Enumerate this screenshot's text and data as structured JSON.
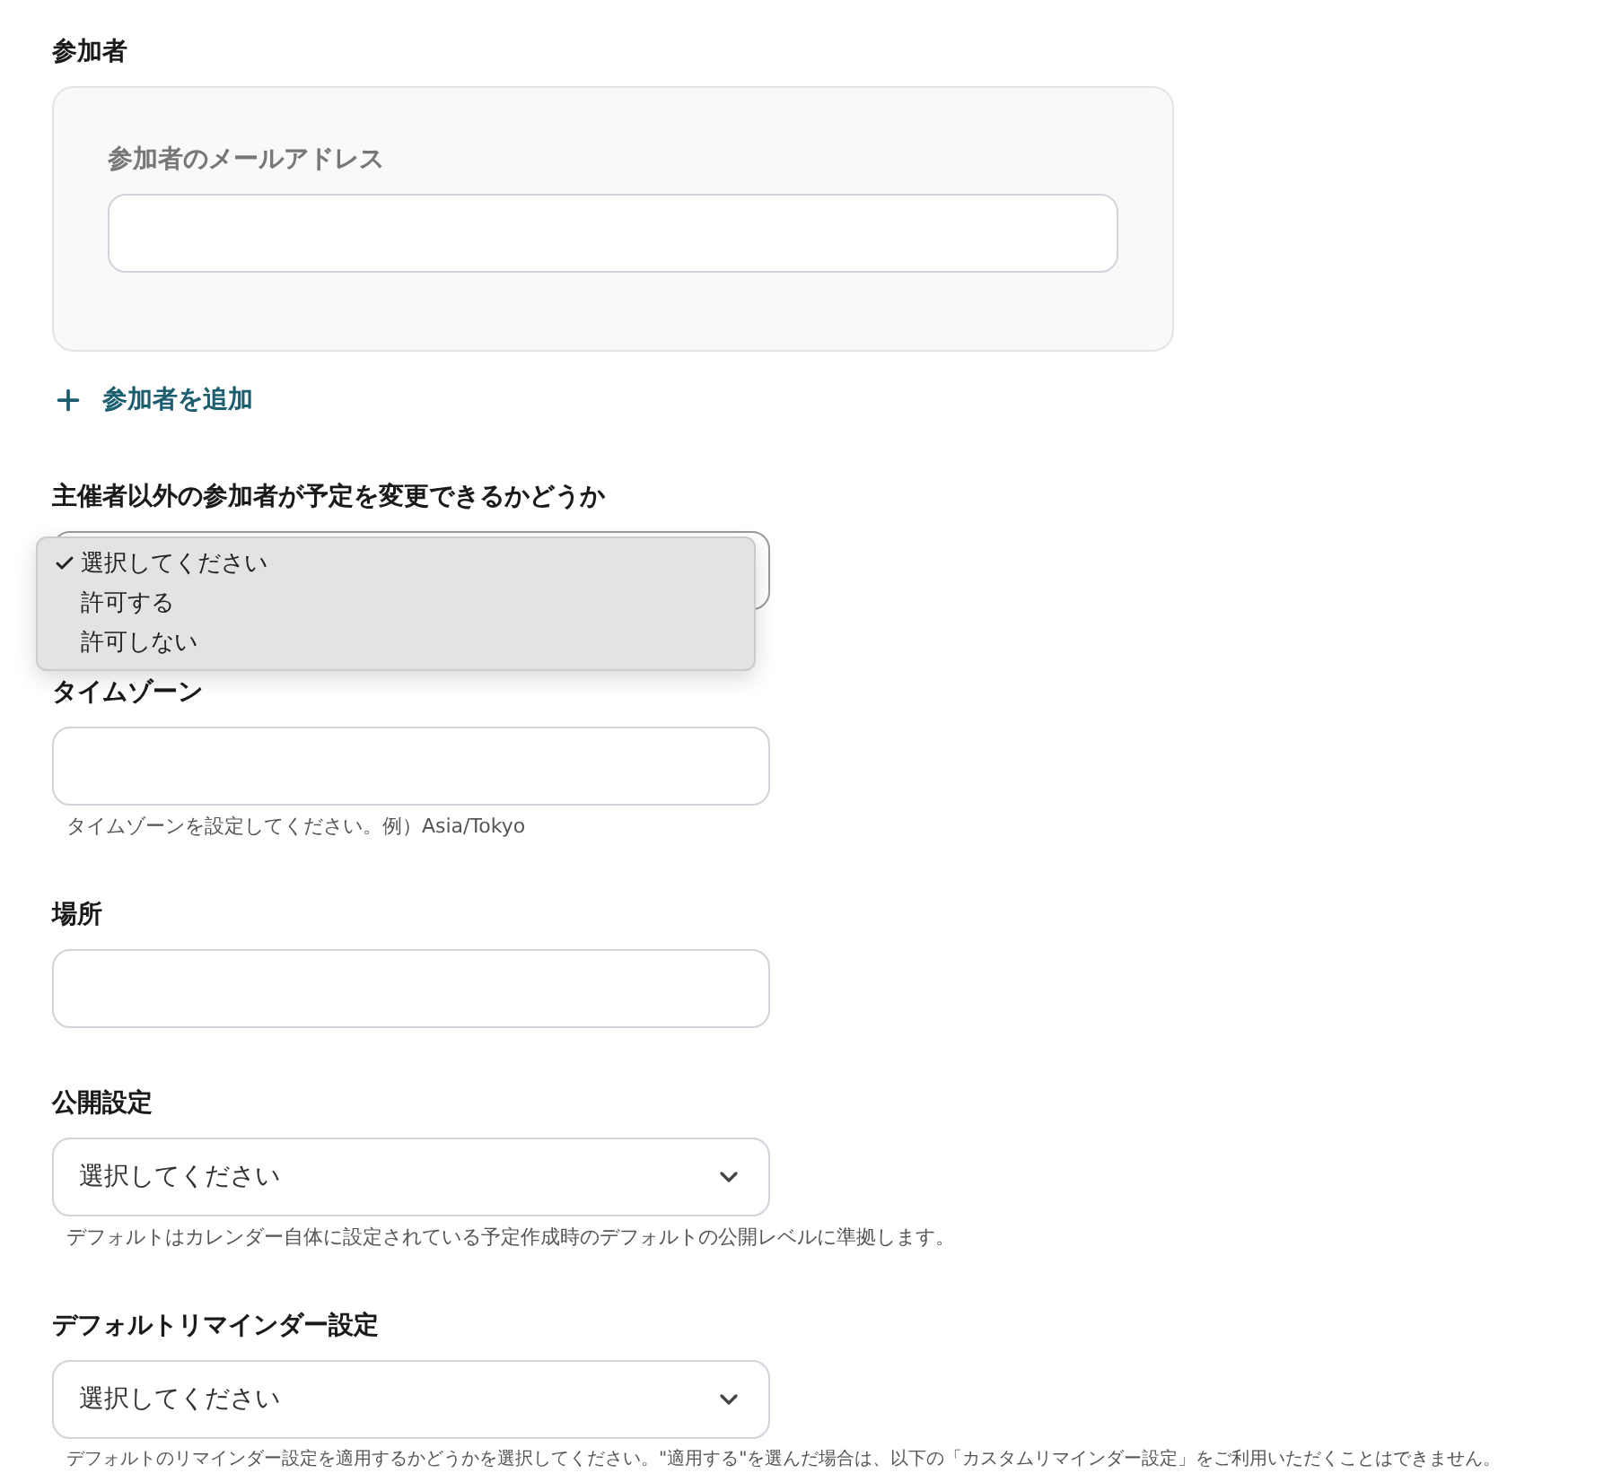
{
  "attendees": {
    "label": "参加者",
    "email_label": "参加者のメールアドレス",
    "add_button": "参加者を追加"
  },
  "fields": [
    {
      "kind": "open-select",
      "label": "主催者以外の参加者が予定を変更できるかどうか",
      "options": [
        {
          "label": "選択してください",
          "selected": true
        },
        {
          "label": "許可する",
          "selected": false
        },
        {
          "label": "許可しない",
          "selected": false
        }
      ]
    },
    {
      "kind": "text",
      "label": "タイムゾーン",
      "help": "タイムゾーンを設定してください。例）Asia/Tokyo"
    },
    {
      "kind": "text",
      "label": "場所"
    },
    {
      "kind": "select",
      "label": "公開設定",
      "value": "選択してください",
      "help": "デフォルトはカレンダー自体に設定されている予定作成時のデフォルトの公開レベルに準拠します。"
    },
    {
      "kind": "select",
      "label": "デフォルトリマインダー設定",
      "value": "選択してください",
      "help": "デフォルトのリマインダー設定を適用するかどうかを選択してください。\"適用する\"を選んだ場合は、以下の「カスタムリマインダー設定」をご利用いただくことはできません。"
    }
  ]
}
